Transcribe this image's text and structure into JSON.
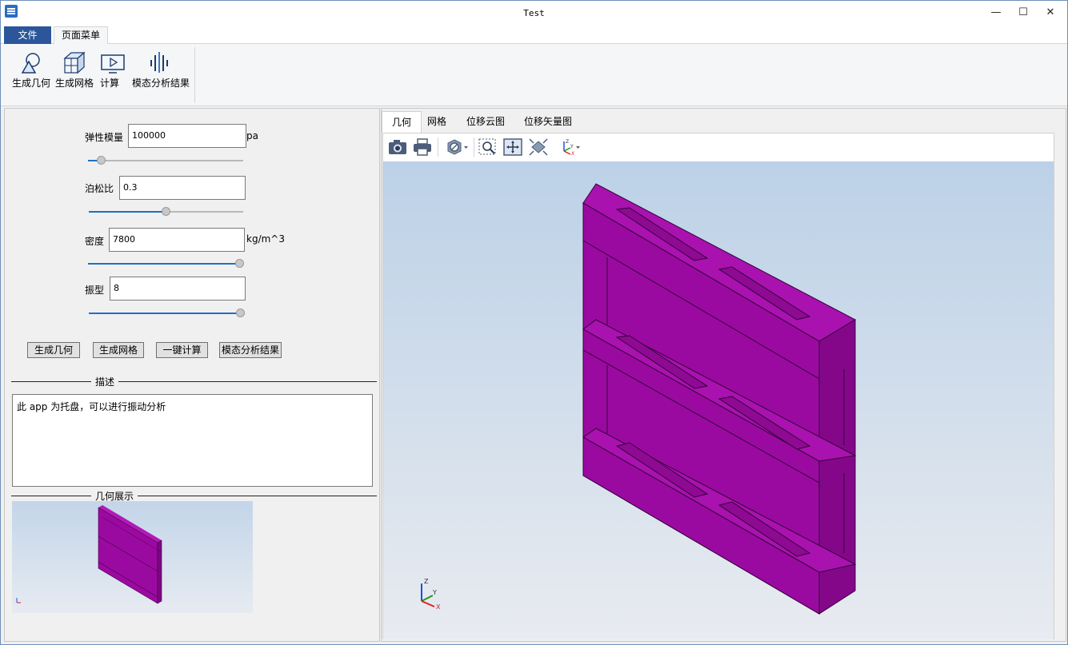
{
  "window": {
    "title": "Test",
    "controls": [
      "minimize",
      "maximize",
      "close"
    ]
  },
  "ribbon": {
    "tabs": [
      {
        "label": "文件",
        "active": false
      },
      {
        "label": "页面菜单",
        "active": true
      }
    ],
    "buttons": [
      {
        "label": "生成几何",
        "icon": "geometry-icon"
      },
      {
        "label": "生成网格",
        "icon": "mesh-icon"
      },
      {
        "label": "计算",
        "icon": "compute-icon"
      },
      {
        "label": "模态分析结果",
        "icon": "modal-result-icon"
      }
    ]
  },
  "params": {
    "elastic_label": "弹性模量",
    "elastic_value": "100000",
    "elastic_unit": "pa",
    "elastic_slider": 0.06,
    "poisson_label": "泊松比",
    "poisson_value": "0.3",
    "poisson_slider": 0.5,
    "density_label": "密度",
    "density_value": "7800",
    "density_unit": "kg/m^3",
    "density_slider": 1.0,
    "mode_label": "振型",
    "mode_value": "8",
    "mode_slider": 1.0
  },
  "actions": {
    "gen_geometry": "生成几何",
    "gen_mesh": "生成网格",
    "compute": "一键计算",
    "modal_result": "模态分析结果"
  },
  "description": {
    "title": "描述",
    "text": "此 app 为托盘，可以进行振动分析"
  },
  "preview": {
    "title": "几何展示"
  },
  "viewer": {
    "tabs": [
      "几何",
      "网格",
      "位移云图",
      "位移矢量图"
    ],
    "active_tab": 0,
    "toolbar": [
      "camera-icon",
      "print-icon",
      "visibility-icon",
      "zoom-box-icon",
      "fit-view-icon",
      "reset-view-icon",
      "axes-orient-icon"
    ],
    "model_color": "#9b0aa0",
    "axes": {
      "x": "X",
      "y": "Y",
      "z": "Z"
    }
  },
  "colors": {
    "accent": "#2b579a",
    "slider_fill": "#1f6fc5"
  }
}
